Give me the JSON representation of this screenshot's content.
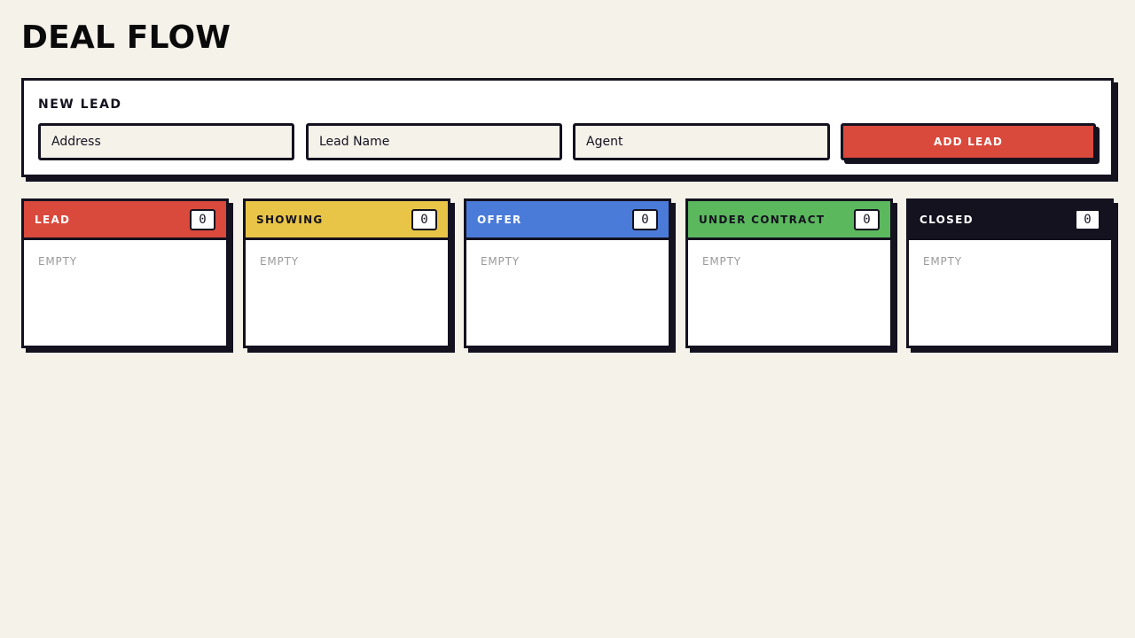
{
  "page": {
    "title": "DEAL FLOW"
  },
  "new_lead": {
    "heading": "NEW LEAD",
    "address_placeholder": "Address",
    "name_placeholder": "Lead Name",
    "agent_placeholder": "Agent",
    "add_label": "ADD LEAD"
  },
  "columns": [
    {
      "title": "LEAD",
      "count": "0",
      "empty": "EMPTY",
      "color": "#d9493c",
      "text_color": "#ffffff"
    },
    {
      "title": "SHOWING",
      "count": "0",
      "empty": "EMPTY",
      "color": "#e9c547",
      "text_color": "#14121f"
    },
    {
      "title": "OFFER",
      "count": "0",
      "empty": "EMPTY",
      "color": "#4a7bd8",
      "text_color": "#ffffff"
    },
    {
      "title": "UNDER CONTRACT",
      "count": "0",
      "empty": "EMPTY",
      "color": "#5bb85d",
      "text_color": "#14121f"
    },
    {
      "title": "CLOSED",
      "count": "0",
      "empty": "EMPTY",
      "color": "#14121f",
      "text_color": "#ffffff"
    }
  ]
}
